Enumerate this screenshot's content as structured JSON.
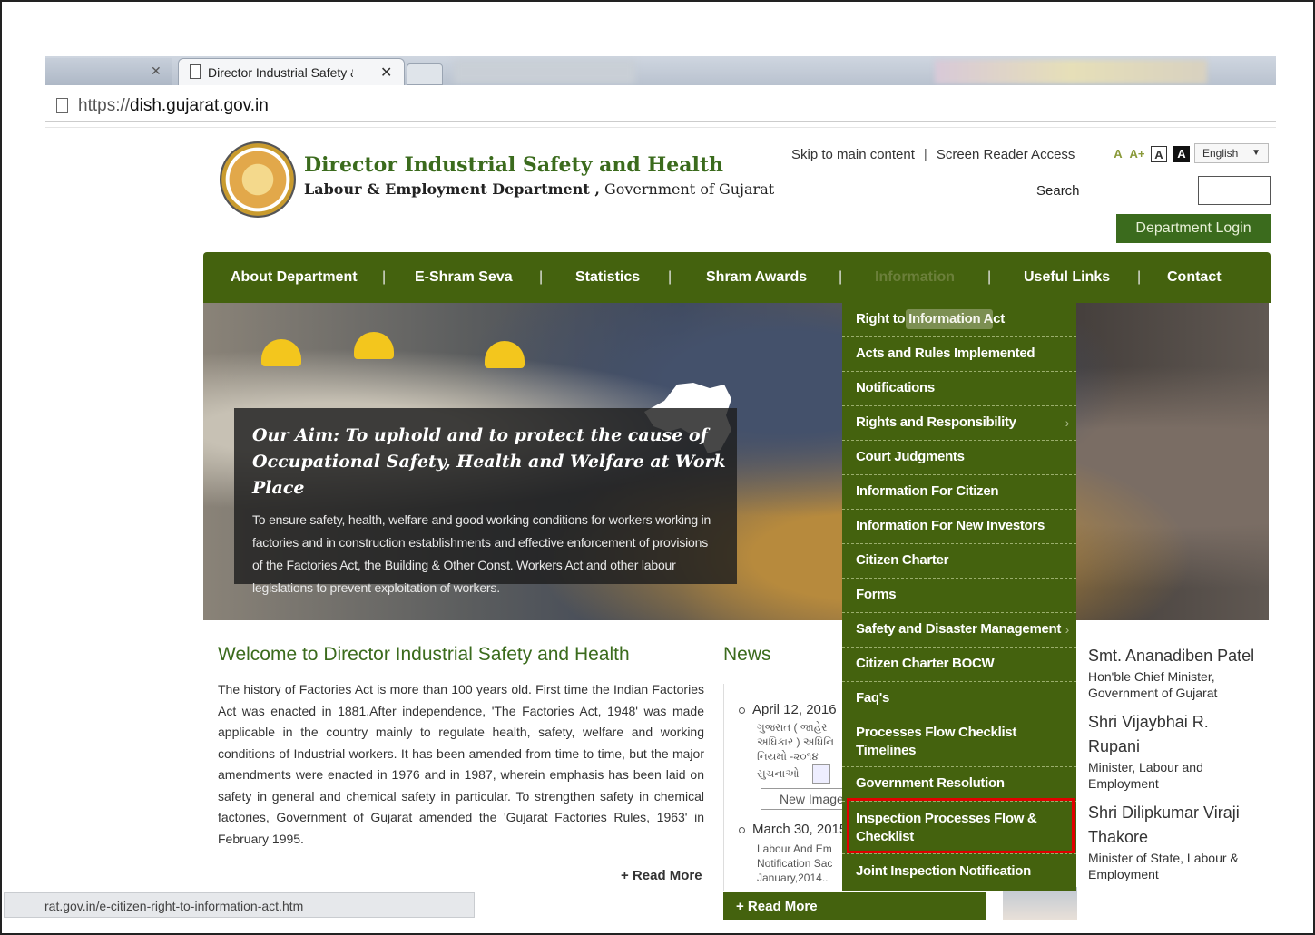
{
  "browser": {
    "active_tab_title": "Director Industrial Safety &",
    "url_prefix": "https://",
    "url_host": "dish.gujarat.gov.in",
    "status_url": "rat.gov.in/e-citizen-right-to-information-act.htm"
  },
  "header": {
    "title": "Director Industrial Safety and Health",
    "sub_bold": "Labour & Employment Department ,",
    "sub_rest": " Government of Gujarat",
    "skip_link": "Skip to main content",
    "screen_reader": "Screen Reader Access",
    "font_a_small": "A",
    "font_a_plus": "A+",
    "font_a_normal": "A",
    "font_a_contrast": "A",
    "language": "English",
    "search_label": "Search",
    "dept_login": "Department Login"
  },
  "nav": {
    "items": [
      "About Department",
      "E-Shram Seva",
      "Statistics",
      "Shram Awards",
      "Information",
      "Useful Links",
      "Contact"
    ]
  },
  "hero": {
    "heading": "Our Aim: To uphold and to protect the cause of Occupational Safety, Health and Welfare at Work Place",
    "body": "To ensure safety, health, welfare and good working conditions for workers working in factories and in construction establishments and effective enforcement of provisions of the Factories Act, the Building & Other Const. Workers Act and other labour legislations to prevent exploitation of workers."
  },
  "welcome": {
    "title": "Welcome to Director Industrial Safety and Health",
    "body": "The history of Factories Act is more than 100 years old. First time the Indian Factories Act was enacted in 1881.After independence, 'The Factories Act, 1948' was made applicable in the country mainly to regulate health, safety, welfare and working conditions of Industrial workers. It has been amended from time to time, but the major amendments were enacted in 1976 and in 1987, wherein emphasis has been laid on safety in general and chemical safety in particular. To strengthen safety in chemical factories, Government of Gujarat amended the 'Gujarat Factories Rules, 1963' in February 1995.",
    "read_more": "+ Read More"
  },
  "news": {
    "title": "News",
    "item1_date": "April 12, 2016",
    "item1_line1": "ગુજરાત ( જાહેર",
    "item1_line2": "અધિકાર ) અધિનિ",
    "item1_line3": "નિયમો -૨૦૧૪ ",
    "item1_line4": "સુચનાઓ",
    "new_image": "New Image",
    "item2_date": "March 30, 2015",
    "item2_line1": "Labour And Em",
    "item2_line2": "Notification Sac",
    "item2_line3": "January,2014..",
    "read_more": "+ Read More"
  },
  "ministers": [
    {
      "name": "Smt. Ananadiben Patel",
      "role": "Hon'ble Chief Minister, Government of Gujarat"
    },
    {
      "name": "Shri Vijaybhai R. Rupani",
      "role": "Minister, Labour and Employment"
    },
    {
      "name": "Shri Dilipkumar Viraji Thakore",
      "role": "Minister of State, Labour & Employment"
    }
  ],
  "dropdown": {
    "items": [
      "Right to Information Act",
      "Acts and Rules Implemented",
      "Notifications",
      "Rights and Responsibility",
      "Court Judgments",
      "Information For Citizen",
      "Information For New Investors",
      "Citizen Charter",
      "Forms",
      "Safety and Disaster Management",
      "Citizen Charter BOCW",
      "Faq's",
      "Processes Flow Checklist Timelines",
      "Government Resolution",
      "Inspection Processes Flow & Checklist",
      "Joint Inspection Notification"
    ]
  },
  "colors": {
    "brand_green": "#44620e",
    "title_green": "#3b6b1d",
    "highlight_red": "#e00000"
  }
}
